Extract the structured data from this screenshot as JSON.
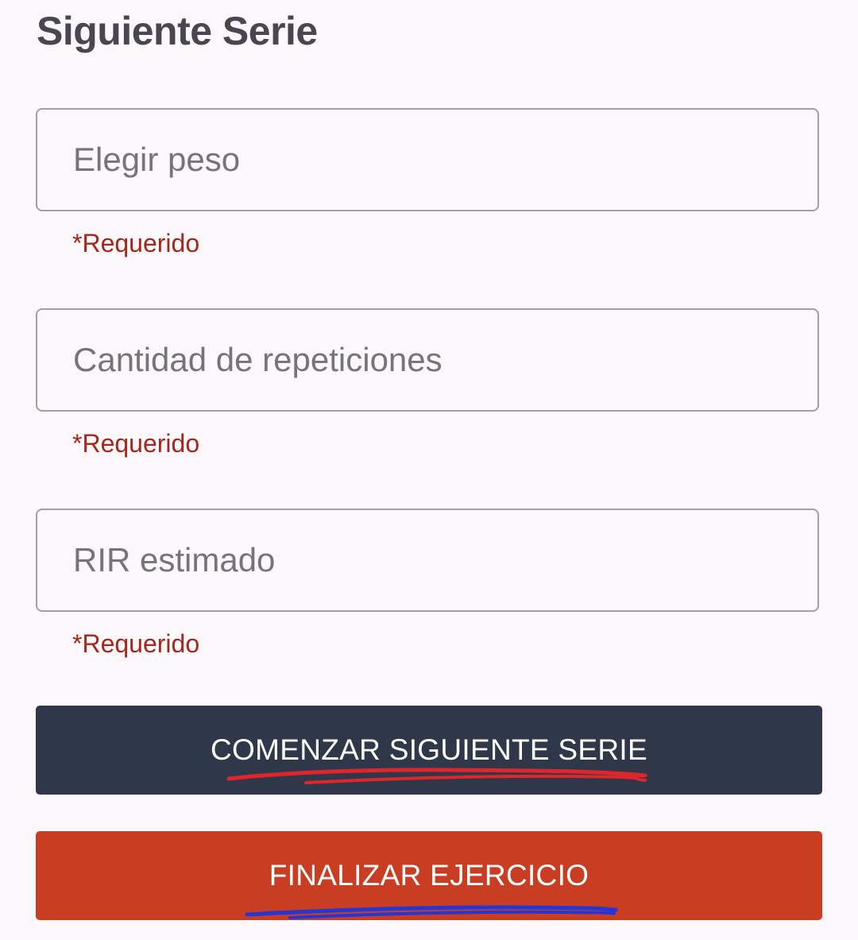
{
  "page": {
    "title": "Siguiente Serie"
  },
  "form": {
    "fields": [
      {
        "placeholder": "Elegir peso",
        "value": "",
        "helper": "*Requerido"
      },
      {
        "placeholder": "Cantidad de repeticiones",
        "value": "",
        "helper": "*Requerido"
      },
      {
        "placeholder": "RIR estimado",
        "value": "",
        "helper": "*Requerido"
      }
    ]
  },
  "actions": {
    "next_label": "COMENZAR SIGUIENTE SERIE",
    "finish_label": "FINALIZAR EJERCICIO"
  },
  "colors": {
    "background": "#fbf7fb",
    "next_button": "#2f3849",
    "finish_button": "#c93e22",
    "required_text": "#a3271b",
    "annotation_red": "#e0262b",
    "annotation_blue": "#2437d6"
  }
}
